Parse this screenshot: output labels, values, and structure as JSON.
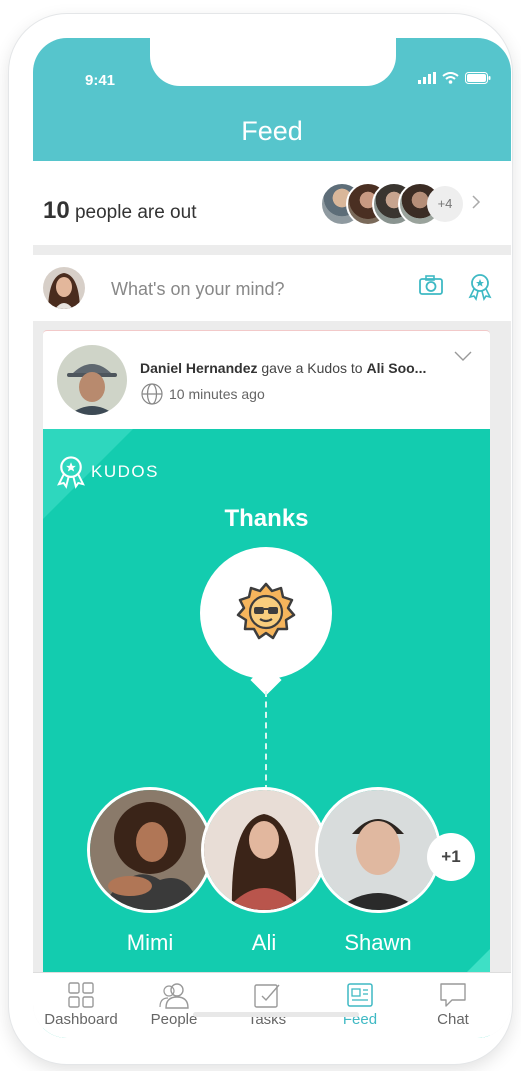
{
  "status_bar": {
    "time": "9:41"
  },
  "header": {
    "title": "Feed"
  },
  "out_row": {
    "count": "10",
    "text": "people are out",
    "more_count": "+4"
  },
  "compose": {
    "placeholder": "What's on your mind?"
  },
  "post": {
    "author": "Daniel Hernandez",
    "action": "gave a Kudos to",
    "recipient": "Ali Soo...",
    "time": "10 minutes ago",
    "kudos_label": "KUDOS",
    "kudos_title": "Thanks",
    "recipients": [
      {
        "name": "Mimi"
      },
      {
        "name": "Ali"
      },
      {
        "name": "Shawn"
      }
    ],
    "extra_recipients": "+1"
  },
  "tabs": [
    {
      "label": "Dashboard",
      "icon": "grid-icon"
    },
    {
      "label": "People",
      "icon": "people-icon"
    },
    {
      "label": "Tasks",
      "icon": "tasks-icon"
    },
    {
      "label": "Feed",
      "icon": "feed-icon"
    },
    {
      "label": "Chat",
      "icon": "chat-icon"
    }
  ],
  "colors": {
    "header": "#56c5cc",
    "kudos_bg": "#13ccaf",
    "active_tab": "#3fb9c4"
  }
}
